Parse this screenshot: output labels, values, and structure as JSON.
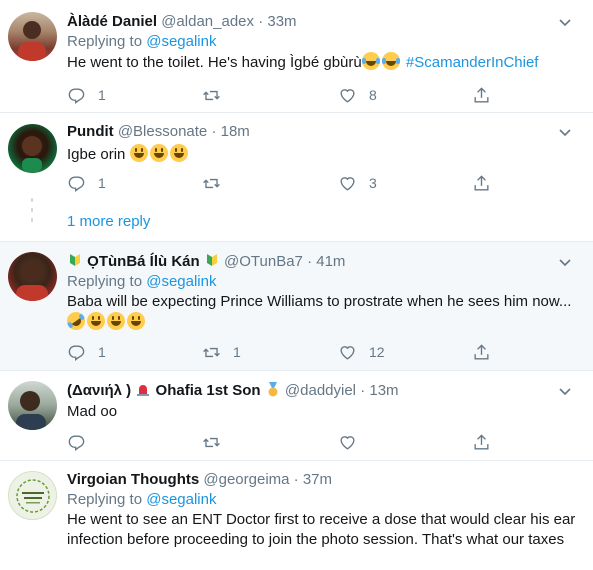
{
  "tweets": [
    {
      "name": "Àlàdé Daniel",
      "handle": "@aldan_adex",
      "dot": "·",
      "time": "33m",
      "replying_prefix": "Replying to",
      "replying_to": "@segalink",
      "text": "He went to the toilet. He's having Ìgbé gbùrù",
      "hashtag": "#ScamanderInChief",
      "reply_count": "1",
      "retweet_count": "",
      "like_count": "8"
    },
    {
      "name": "Pundit",
      "handle": "@Blessonate",
      "dot": "·",
      "time": "18m",
      "text": "Igbe orin",
      "reply_count": "1",
      "retweet_count": "",
      "like_count": "3"
    },
    {
      "name": "ỌTùnBá Ílù Kán",
      "handle": "@OTunBa7",
      "dot": "·",
      "time": "41m",
      "replying_prefix": "Replying to",
      "replying_to": "@segalink",
      "text": "Baba will be expecting Prince Williams to prostrate when he sees him now...",
      "reply_count": "1",
      "retweet_count": "1",
      "like_count": "12"
    },
    {
      "name": "(Δανιήλ )",
      "name2": "Ohafia 1st Son",
      "handle": "@daddyiel",
      "dot": "·",
      "time": "13m",
      "text": "Mad oo",
      "reply_count": "",
      "retweet_count": "",
      "like_count": ""
    },
    {
      "name": "Virgoian Thoughts",
      "handle": "@georgeima",
      "dot": "·",
      "time": "37m",
      "replying_prefix": "Replying to",
      "replying_to": "@segalink",
      "text_line1": "He went to see an ENT Doctor first to receive a dose that would clear his ear",
      "text_line2": "infection before proceeding to join the photo session. That's what our taxes"
    }
  ],
  "more_replies": "1 more reply",
  "colors": {
    "accent": "#1b95e0",
    "muted": "#657786",
    "highlight_bg": "#f5f8fa",
    "divider": "#e6ecf0"
  },
  "icons": [
    "reply-icon",
    "retweet-icon",
    "like-icon",
    "share-icon",
    "chevron-down-icon"
  ]
}
